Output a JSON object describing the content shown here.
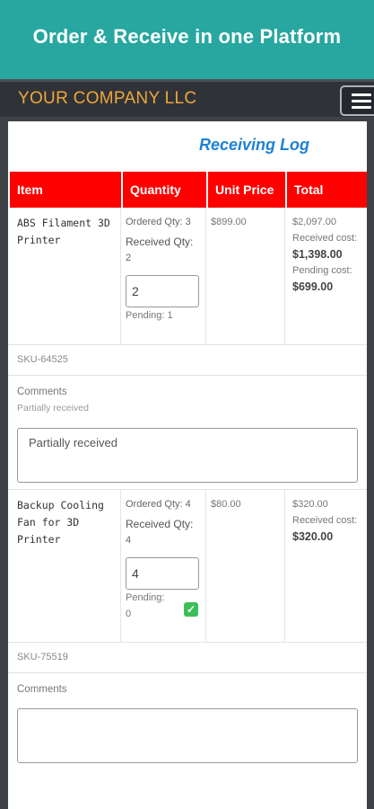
{
  "banner": {
    "title": "Order & Receive in one Platform"
  },
  "navbar": {
    "brand": "YOUR COMPANY LLC",
    "menu_icon": "hamburger-icon"
  },
  "page": {
    "title": "Receiving Log"
  },
  "table": {
    "headers": [
      "Item",
      "Quantity",
      "Unit Price",
      "Total"
    ],
    "header_color": "#ff0000"
  },
  "items": [
    {
      "name": "ABS Filament 3D Printer",
      "ordered_label": "Ordered Qty: 3",
      "received_label": "Received Qty:",
      "received_value": "2",
      "input_value": "2",
      "pending": "Pending: 1",
      "unit_price": "$899.00",
      "total": "$2,097.00",
      "received_cost_label": "Received cost:",
      "received_cost": "$1,398.00",
      "pending_cost_label": "Pending cost:",
      "pending_cost": "$699.00",
      "sku": "SKU-64525",
      "comments_label": "Comments",
      "comments_text": "Partially received",
      "comments_value": "Partially received"
    },
    {
      "name": "Backup Cooling Fan for 3D Printer",
      "ordered_label": "Ordered Qty: 4",
      "received_label": "Received Qty:",
      "received_value": "4",
      "input_value": "4",
      "pending": "Pending:",
      "pending_value": "0",
      "unit_price": "$80.00",
      "total": "$320.00",
      "received_cost_label": "Received cost:",
      "received_cost": "$320.00",
      "sku": "SKU-75519",
      "comments_label": "Comments",
      "comments_value": ""
    }
  ]
}
